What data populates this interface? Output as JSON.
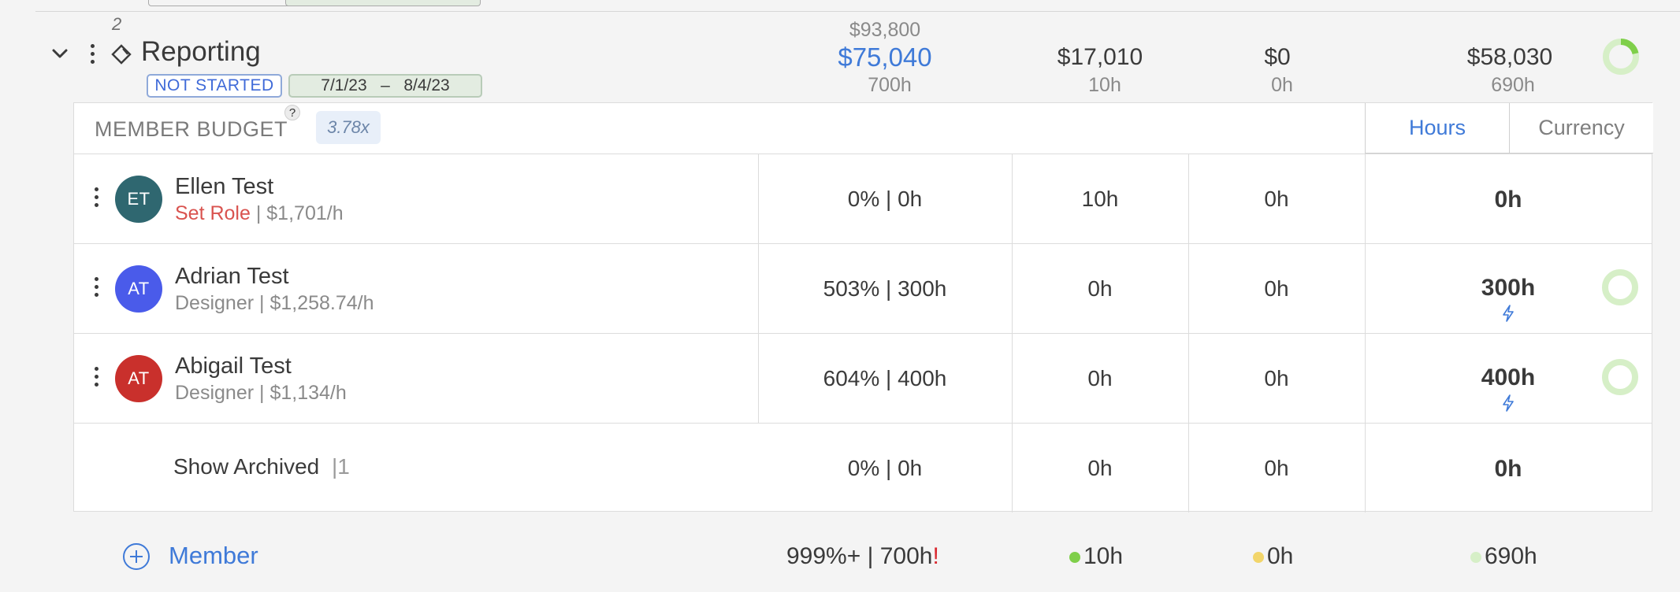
{
  "phase": {
    "number": "2",
    "title": "Reporting",
    "status": "NOT STARTED",
    "dates": "7/1/23   –   8/4/23",
    "budget_total": "$93,800",
    "budget": "$75,040",
    "budget_hours": "700h",
    "spent": "$17,010",
    "spent_hours": "10h",
    "planned": "$0",
    "planned_hours": "0h",
    "remaining": "$58,030",
    "remaining_hours": "690h"
  },
  "member_budget": {
    "title": "MEMBER BUDGET",
    "help": "?",
    "multiplier": "3.78x",
    "toggle": {
      "hours": "Hours",
      "currency": "Currency",
      "active": "Hours"
    }
  },
  "members": [
    {
      "initials": "ET",
      "avatar_color": "#2f6770",
      "name": "Ellen Test",
      "role": "Set Role",
      "role_unset": true,
      "rate": "$1,701/h",
      "budget": "0% | 0h",
      "spent": "10h",
      "planned": "0h",
      "remaining": "0h",
      "bolt": false,
      "donut": false
    },
    {
      "initials": "AT",
      "avatar_color": "#4a5bea",
      "name": "Adrian Test",
      "role": "Designer",
      "role_unset": false,
      "rate": "$1,258.74/h",
      "budget": "503% | 300h",
      "spent": "0h",
      "planned": "0h",
      "remaining": "300h",
      "bolt": true,
      "donut": true
    },
    {
      "initials": "AT",
      "avatar_color": "#c9302c",
      "name": "Abigail Test",
      "role": "Designer",
      "role_unset": false,
      "rate": "$1,134/h",
      "budget": "604% | 400h",
      "spent": "0h",
      "planned": "0h",
      "remaining": "400h",
      "bolt": true,
      "donut": true
    }
  ],
  "archived": {
    "label": "Show Archived",
    "count": "|1",
    "budget": "0% | 0h",
    "spent": "0h",
    "planned": "0h",
    "remaining": "0h"
  },
  "footer": {
    "add_label": "Member",
    "budget": "999%+ | 700h",
    "budget_alert": "!",
    "spent": "10h",
    "planned": "0h",
    "remaining": "690h"
  },
  "colors": {
    "accent": "#3f7ad8",
    "spent_dot": "#7fcf4a",
    "planned_dot": "#f2d56a",
    "remaining_dot": "#d6efc7",
    "alert": "#d9282f"
  }
}
